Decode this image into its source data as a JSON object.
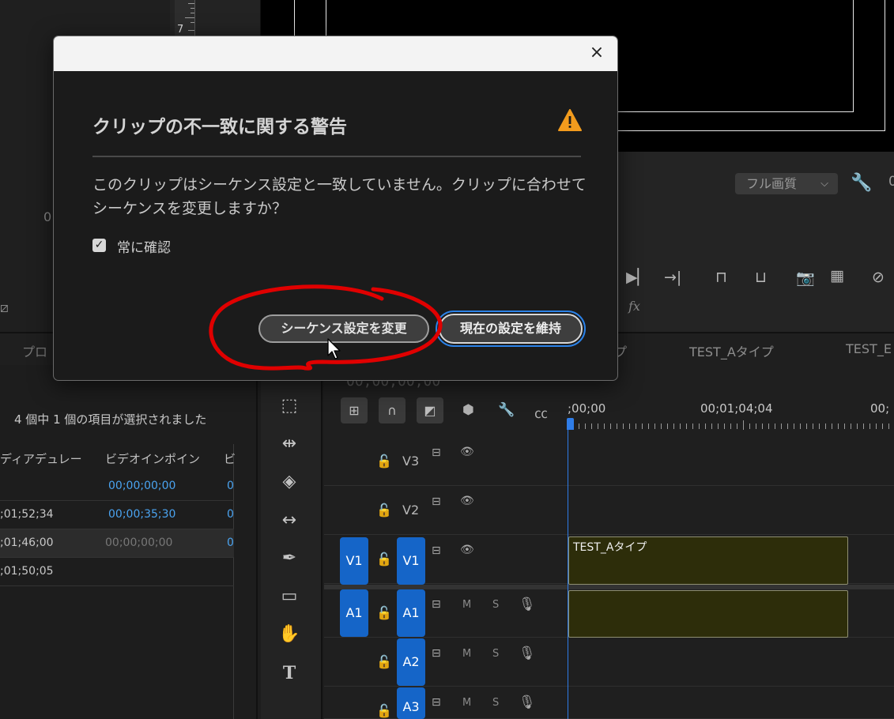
{
  "dialog": {
    "heading": "クリップの不一致に関する警告",
    "message": "このクリップはシーケンス設定と一致していません。クリップに合わせてシーケンスを変更しますか？",
    "checkbox_label": "常に確認",
    "checkbox_checked": true,
    "btn_change": "シーケンス設定を変更",
    "btn_keep": "現在の設定を維持",
    "close_icon": "×",
    "warning_color": "#f29b1d"
  },
  "monitor": {
    "quality": "フル画質",
    "fx": "fx",
    "edge_zero": "0"
  },
  "source": {
    "zero": "0",
    "ruler_num": "7"
  },
  "tabs": {
    "project": "プロ",
    "trunc": "プ",
    "seq1": "TEST_Aタイプ",
    "seq2": "TEST_E"
  },
  "project": {
    "selection_status": "4 個中 1 個の項目が選択されました",
    "headers": [
      "ディアデュレー",
      "ビデオインポイン",
      "ビ"
    ],
    "rows": [
      {
        "duration": "",
        "video_in": "00;00;00;00",
        "extra": "0"
      },
      {
        "duration": ";01;52;34",
        "video_in": "00;00;35;30",
        "extra": "0"
      },
      {
        "duration": ";01;46;00",
        "video_in": "00;00;00;00",
        "extra": "0"
      },
      {
        "duration": ";01;50;05",
        "video_in": "",
        "extra": ""
      }
    ]
  },
  "timeline": {
    "timecode": "00;00;00;00",
    "time_start": ";00;00",
    "time_mid": "00;01;04;04",
    "time_end": "00;",
    "clip_name": "TEST_Aタイプ",
    "tracks": {
      "v3": "V3",
      "v2": "V2",
      "v1": "V1",
      "a1": "A1",
      "a2": "A2",
      "a3": "A3",
      "v1_source": "V1",
      "a1_source": "A1",
      "m": "M",
      "s": "S"
    }
  },
  "colors": {
    "accent_blue": "#1565c8",
    "annotation_red": "#e00000",
    "clip_fill": "#2d2d0a"
  }
}
